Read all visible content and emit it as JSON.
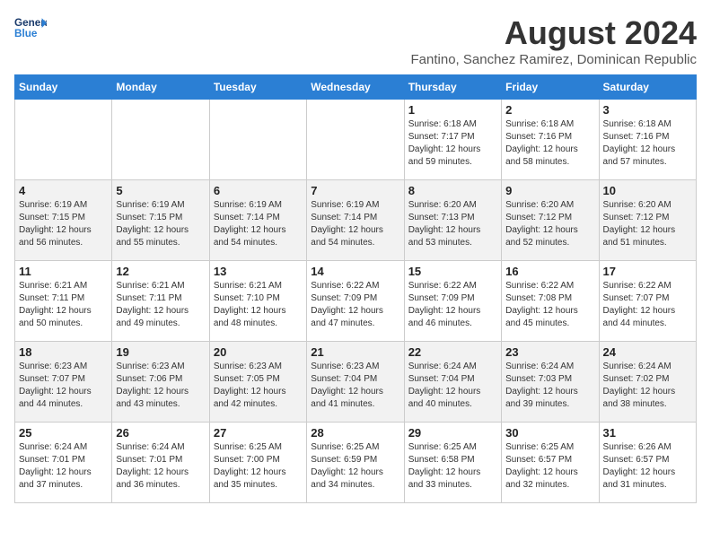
{
  "header": {
    "logo_line1": "General",
    "logo_line2": "Blue",
    "month_year": "August 2024",
    "location": "Fantino, Sanchez Ramirez, Dominican Republic"
  },
  "weekdays": [
    "Sunday",
    "Monday",
    "Tuesday",
    "Wednesday",
    "Thursday",
    "Friday",
    "Saturday"
  ],
  "weeks": [
    [
      {
        "day": "",
        "info": ""
      },
      {
        "day": "",
        "info": ""
      },
      {
        "day": "",
        "info": ""
      },
      {
        "day": "",
        "info": ""
      },
      {
        "day": "1",
        "info": "Sunrise: 6:18 AM\nSunset: 7:17 PM\nDaylight: 12 hours\nand 59 minutes."
      },
      {
        "day": "2",
        "info": "Sunrise: 6:18 AM\nSunset: 7:16 PM\nDaylight: 12 hours\nand 58 minutes."
      },
      {
        "day": "3",
        "info": "Sunrise: 6:18 AM\nSunset: 7:16 PM\nDaylight: 12 hours\nand 57 minutes."
      }
    ],
    [
      {
        "day": "4",
        "info": "Sunrise: 6:19 AM\nSunset: 7:15 PM\nDaylight: 12 hours\nand 56 minutes."
      },
      {
        "day": "5",
        "info": "Sunrise: 6:19 AM\nSunset: 7:15 PM\nDaylight: 12 hours\nand 55 minutes."
      },
      {
        "day": "6",
        "info": "Sunrise: 6:19 AM\nSunset: 7:14 PM\nDaylight: 12 hours\nand 54 minutes."
      },
      {
        "day": "7",
        "info": "Sunrise: 6:19 AM\nSunset: 7:14 PM\nDaylight: 12 hours\nand 54 minutes."
      },
      {
        "day": "8",
        "info": "Sunrise: 6:20 AM\nSunset: 7:13 PM\nDaylight: 12 hours\nand 53 minutes."
      },
      {
        "day": "9",
        "info": "Sunrise: 6:20 AM\nSunset: 7:12 PM\nDaylight: 12 hours\nand 52 minutes."
      },
      {
        "day": "10",
        "info": "Sunrise: 6:20 AM\nSunset: 7:12 PM\nDaylight: 12 hours\nand 51 minutes."
      }
    ],
    [
      {
        "day": "11",
        "info": "Sunrise: 6:21 AM\nSunset: 7:11 PM\nDaylight: 12 hours\nand 50 minutes."
      },
      {
        "day": "12",
        "info": "Sunrise: 6:21 AM\nSunset: 7:11 PM\nDaylight: 12 hours\nand 49 minutes."
      },
      {
        "day": "13",
        "info": "Sunrise: 6:21 AM\nSunset: 7:10 PM\nDaylight: 12 hours\nand 48 minutes."
      },
      {
        "day": "14",
        "info": "Sunrise: 6:22 AM\nSunset: 7:09 PM\nDaylight: 12 hours\nand 47 minutes."
      },
      {
        "day": "15",
        "info": "Sunrise: 6:22 AM\nSunset: 7:09 PM\nDaylight: 12 hours\nand 46 minutes."
      },
      {
        "day": "16",
        "info": "Sunrise: 6:22 AM\nSunset: 7:08 PM\nDaylight: 12 hours\nand 45 minutes."
      },
      {
        "day": "17",
        "info": "Sunrise: 6:22 AM\nSunset: 7:07 PM\nDaylight: 12 hours\nand 44 minutes."
      }
    ],
    [
      {
        "day": "18",
        "info": "Sunrise: 6:23 AM\nSunset: 7:07 PM\nDaylight: 12 hours\nand 44 minutes."
      },
      {
        "day": "19",
        "info": "Sunrise: 6:23 AM\nSunset: 7:06 PM\nDaylight: 12 hours\nand 43 minutes."
      },
      {
        "day": "20",
        "info": "Sunrise: 6:23 AM\nSunset: 7:05 PM\nDaylight: 12 hours\nand 42 minutes."
      },
      {
        "day": "21",
        "info": "Sunrise: 6:23 AM\nSunset: 7:04 PM\nDaylight: 12 hours\nand 41 minutes."
      },
      {
        "day": "22",
        "info": "Sunrise: 6:24 AM\nSunset: 7:04 PM\nDaylight: 12 hours\nand 40 minutes."
      },
      {
        "day": "23",
        "info": "Sunrise: 6:24 AM\nSunset: 7:03 PM\nDaylight: 12 hours\nand 39 minutes."
      },
      {
        "day": "24",
        "info": "Sunrise: 6:24 AM\nSunset: 7:02 PM\nDaylight: 12 hours\nand 38 minutes."
      }
    ],
    [
      {
        "day": "25",
        "info": "Sunrise: 6:24 AM\nSunset: 7:01 PM\nDaylight: 12 hours\nand 37 minutes."
      },
      {
        "day": "26",
        "info": "Sunrise: 6:24 AM\nSunset: 7:01 PM\nDaylight: 12 hours\nand 36 minutes."
      },
      {
        "day": "27",
        "info": "Sunrise: 6:25 AM\nSunset: 7:00 PM\nDaylight: 12 hours\nand 35 minutes."
      },
      {
        "day": "28",
        "info": "Sunrise: 6:25 AM\nSunset: 6:59 PM\nDaylight: 12 hours\nand 34 minutes."
      },
      {
        "day": "29",
        "info": "Sunrise: 6:25 AM\nSunset: 6:58 PM\nDaylight: 12 hours\nand 33 minutes."
      },
      {
        "day": "30",
        "info": "Sunrise: 6:25 AM\nSunset: 6:57 PM\nDaylight: 12 hours\nand 32 minutes."
      },
      {
        "day": "31",
        "info": "Sunrise: 6:26 AM\nSunset: 6:57 PM\nDaylight: 12 hours\nand 31 minutes."
      }
    ]
  ]
}
